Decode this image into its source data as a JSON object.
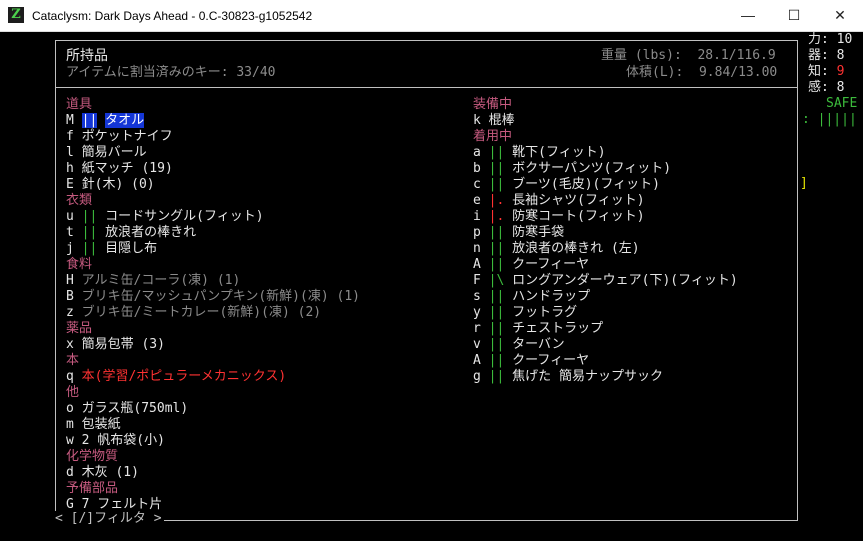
{
  "window": {
    "title": "Cataclysm: Dark Days Ahead - 0.C-30823-g1052542",
    "icon": "Z",
    "minimize": "—",
    "maximize": "☐",
    "close": "✕"
  },
  "header": {
    "title": "所持品",
    "assigned_keys": "アイテムに割当済みのキー: 33/40",
    "weight": "重量 (lbs):  28.1/116.9",
    "volume": "体積(L):  9.84/13.00"
  },
  "left_column": [
    {
      "type": "cat",
      "text": "道具"
    },
    {
      "type": "item",
      "key": "M",
      "marker": "||",
      "name": "タオル",
      "selected": true
    },
    {
      "type": "item",
      "key": "f",
      "marker": "",
      "name": "ポケットナイフ"
    },
    {
      "type": "item",
      "key": "l",
      "marker": "",
      "name": "簡易バール"
    },
    {
      "type": "item",
      "key": "h",
      "marker": "",
      "name": "紙マッチ (19)"
    },
    {
      "type": "item",
      "key": "E",
      "marker": "",
      "name": "針(木) (0)"
    },
    {
      "type": "cat",
      "text": "衣類"
    },
    {
      "type": "item",
      "key": "u",
      "marker": "||",
      "name": "コードサングル(フィット)"
    },
    {
      "type": "item",
      "key": "t",
      "marker": "||",
      "name": "放浪者の棒きれ"
    },
    {
      "type": "item",
      "key": "j",
      "marker": "||",
      "name": "目隠し布"
    },
    {
      "type": "cat",
      "text": "食料"
    },
    {
      "type": "item",
      "key": "H",
      "marker": "",
      "name": "アルミ缶/コーラ(凍) (1)",
      "style": "gray"
    },
    {
      "type": "item",
      "key": "B",
      "marker": "",
      "name": "ブリキ缶/マッシュパンプキン(新鮮)(凍) (1)",
      "style": "gray"
    },
    {
      "type": "item",
      "key": "z",
      "marker": "",
      "name": "ブリキ缶/ミートカレー(新鮮)(凍) (2)",
      "style": "gray"
    },
    {
      "type": "cat",
      "text": "薬品"
    },
    {
      "type": "item",
      "key": "x",
      "marker": "",
      "name": "簡易包帯 (3)"
    },
    {
      "type": "cat",
      "text": "本"
    },
    {
      "type": "item",
      "key": "q",
      "marker": "",
      "name": "本(学習/ポピュラーメカニックス)",
      "style": "red"
    },
    {
      "type": "cat",
      "text": "他"
    },
    {
      "type": "item",
      "key": "o",
      "marker": "",
      "name": "ガラス瓶(750ml)"
    },
    {
      "type": "item",
      "key": "m",
      "marker": "",
      "name": "包装紙"
    },
    {
      "type": "item",
      "key": "w",
      "marker": "",
      "name": "2 帆布袋(小)"
    },
    {
      "type": "cat",
      "text": "化学物質"
    },
    {
      "type": "item",
      "key": "d",
      "marker": "",
      "name": "木灰 (1)"
    },
    {
      "type": "cat",
      "text": "予備部品"
    },
    {
      "type": "item",
      "key": "G",
      "marker": "",
      "name": "7 フェルト片"
    }
  ],
  "right_column": [
    {
      "type": "cat",
      "text": "装備中"
    },
    {
      "type": "item",
      "key": "k",
      "marker": "",
      "name": "棍棒"
    },
    {
      "type": "cat",
      "text": "着用中"
    },
    {
      "type": "item",
      "key": "a",
      "marker": "||",
      "name": "靴下(フィット)"
    },
    {
      "type": "item",
      "key": "b",
      "marker": "||",
      "name": "ボクサーパンツ(フィット)"
    },
    {
      "type": "item",
      "key": "c",
      "marker": "||",
      "name": "ブーツ(毛皮)(フィット)"
    },
    {
      "type": "item",
      "key": "e",
      "marker": "|.",
      "name": "長袖シャツ(フィット)",
      "marker_style": "red"
    },
    {
      "type": "item",
      "key": "i",
      "marker": "|.",
      "name": "防寒コート(フィット)",
      "marker_style": "red"
    },
    {
      "type": "item",
      "key": "p",
      "marker": "||",
      "name": "防寒手袋"
    },
    {
      "type": "item",
      "key": "n",
      "marker": "||",
      "name": "放浪者の棒きれ (左)"
    },
    {
      "type": "item",
      "key": "A",
      "marker": "||",
      "name": "クーフィーヤ"
    },
    {
      "type": "item",
      "key": "F",
      "marker": "|\\",
      "name": "ロングアンダーウェア(下)(フィット)"
    },
    {
      "type": "item",
      "key": "s",
      "marker": "||",
      "name": "ハンドラップ"
    },
    {
      "type": "item",
      "key": "y",
      "marker": "||",
      "name": "フットラグ"
    },
    {
      "type": "item",
      "key": "r",
      "marker": "||",
      "name": "チェストラップ"
    },
    {
      "type": "item",
      "key": "v",
      "marker": "||",
      "name": "ターバン"
    },
    {
      "type": "item",
      "key": "A",
      "marker": "||",
      "name": "クーフィーヤ"
    },
    {
      "type": "item",
      "key": "g",
      "marker": "||",
      "name": "焦げた 簡易ナップサック"
    }
  ],
  "filter": "< [/]フィルタ >",
  "sidebar": {
    "stats": [
      {
        "label": "力",
        "value": "10",
        "color": "#e6e6e6"
      },
      {
        "label": "器",
        "value": "8",
        "color": "#e6e6e6"
      },
      {
        "label": "知",
        "value": "9",
        "color": "#ff3232"
      },
      {
        "label": "感",
        "value": "8",
        "color": "#e6e6e6"
      }
    ],
    "safe": "SAFE",
    "bar": ": |||||",
    "bracket": "]"
  },
  "colors": {
    "category": "#c55a7f",
    "marker_green": "#3cbb3c",
    "selected_bg": "#1436d6",
    "text": "#c0c0c0"
  }
}
